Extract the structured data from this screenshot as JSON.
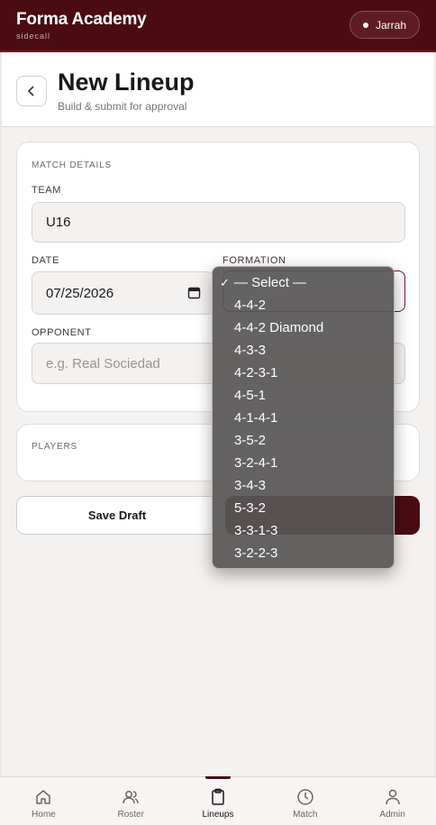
{
  "app": {
    "name": "Forma Academy",
    "subtitle": "sidecall",
    "user": "Jarrah"
  },
  "header": {
    "back_icon": "chevron-left-icon",
    "title": "New Lineup",
    "subtitle": "Build & submit for approval"
  },
  "match_details": {
    "section_label": "MATCH DETAILS",
    "team": {
      "label": "TEAM",
      "value": "U16"
    },
    "date": {
      "label": "DATE",
      "value": "07/25/2026"
    },
    "formation": {
      "label": "FORMATION",
      "selected": "— Select —"
    },
    "opponent": {
      "label": "OPPONENT",
      "placeholder": "e.g. Real Sociedad"
    }
  },
  "players": {
    "section_label": "PLAYERS"
  },
  "actions": {
    "save_draft": "Save Draft"
  },
  "formation_options": [
    {
      "label": "— Select —",
      "selected": true
    },
    {
      "label": "4-4-2"
    },
    {
      "label": "4-4-2 Diamond"
    },
    {
      "label": "4-3-3"
    },
    {
      "label": "4-2-3-1"
    },
    {
      "label": "4-5-1"
    },
    {
      "label": "4-1-4-1"
    },
    {
      "label": "3-5-2"
    },
    {
      "label": "3-2-4-1"
    },
    {
      "label": "3-4-3"
    },
    {
      "label": "5-3-2"
    },
    {
      "label": "3-3-1-3"
    },
    {
      "label": "3-2-2-3"
    }
  ],
  "nav": [
    {
      "label": "Home",
      "icon": "home-icon"
    },
    {
      "label": "Roster",
      "icon": "users-icon"
    },
    {
      "label": "Lineups",
      "icon": "clipboard-icon",
      "active": true
    },
    {
      "label": "Match",
      "icon": "clock-icon"
    },
    {
      "label": "Admin",
      "icon": "person-icon"
    }
  ],
  "colors": {
    "brand": "#4a0c12",
    "accent": "#7a1520",
    "background": "#f4f2f0"
  }
}
